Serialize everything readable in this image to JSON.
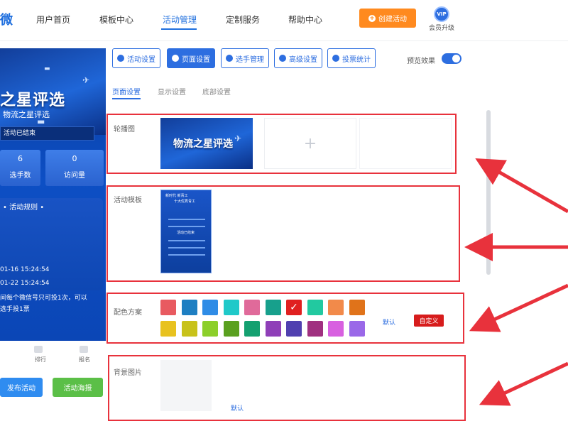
{
  "nav": {
    "logo_fragment": "微",
    "items": [
      "用户首页",
      "模板中心",
      "活动管理",
      "定制服务",
      "帮助中心"
    ],
    "active_index": 2,
    "create_button": "创建活动",
    "vip_badge": "VIP",
    "vip_label": "会员升级"
  },
  "preview": {
    "banner_title": "之星评选",
    "activity_name": "物流之星评选",
    "status": "活动已结束",
    "stats": [
      {
        "value": "6",
        "label": "选手数"
      },
      {
        "value": "0",
        "label": "访问量"
      }
    ],
    "rules_title": "活动规则",
    "rules_lines": [
      "01-16 15:24:54",
      "01-22 15:24:54",
      "间每个微信号只可投1次，可以",
      "选手投1票"
    ],
    "tabbar": [
      "排行",
      "报名"
    ],
    "publish_button": "发布活动",
    "poster_button": "活动海报"
  },
  "toolbar": {
    "buttons": [
      "活动设置",
      "页面设置",
      "选手管理",
      "高级设置",
      "投票统计"
    ],
    "active_index": 1,
    "preview_toggle_label": "预览效果",
    "preview_toggle_on": true
  },
  "subtabs": {
    "items": [
      "页面设置",
      "显示设置",
      "底部设置"
    ],
    "active_index": 0
  },
  "sections": {
    "carousel": {
      "label": "轮播图",
      "image_title": "物流之星评选",
      "add_symbol": "+"
    },
    "template": {
      "label": "活动模板",
      "thumb_lines": [
        "新时代 新青工",
        "十大优秀青工",
        "活动已结束"
      ]
    },
    "colors": {
      "label": "配色方案",
      "swatches_row1": [
        "#e85a60",
        "#1e7fc2",
        "#2f8ce6",
        "#1fc9c9",
        "#e06a9a",
        "#17a08c",
        "#e02020",
        "#22c9a0",
        "#f28a4a",
        "#e0731a"
      ],
      "swatches_row2": [
        "#e8c21f",
        "#c8c21a",
        "#8ccf2a",
        "#5aa01f",
        "#14a070",
        "#8f3fb8",
        "#5040b0",
        "#a03080",
        "#d860e0",
        "#9a68e8"
      ],
      "selected_index": 6,
      "default_link": "默认",
      "custom_button": "自定义"
    },
    "background": {
      "label": "背景图片",
      "default_link": "默认"
    }
  }
}
